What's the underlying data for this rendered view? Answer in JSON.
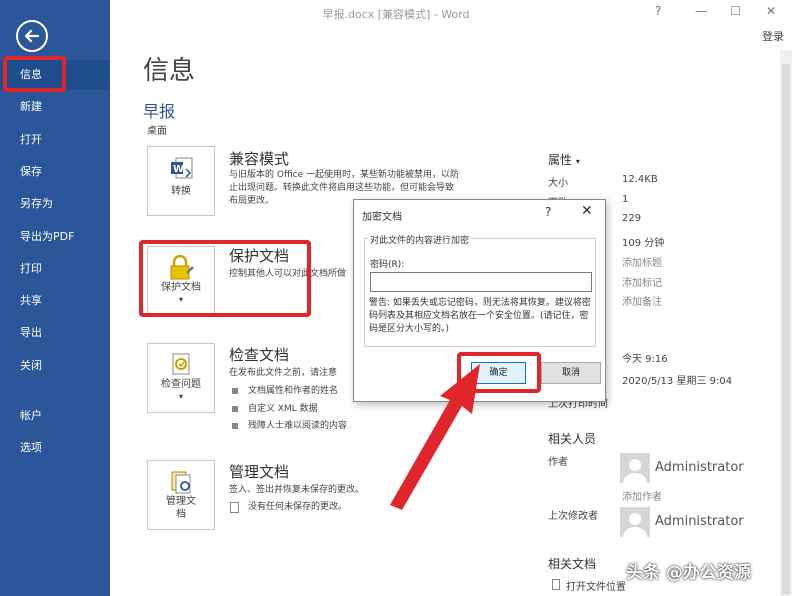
{
  "titlebar": {
    "title": "早报.docx [兼容模式] - Word",
    "help": "?",
    "minimize": "—",
    "restore": "☐",
    "close": "✕",
    "login": "登录"
  },
  "sidebar": {
    "items": [
      {
        "label": "信息"
      },
      {
        "label": "新建"
      },
      {
        "label": "打开"
      },
      {
        "label": "保存"
      },
      {
        "label": "另存为"
      },
      {
        "label": "导出为PDF"
      },
      {
        "label": "打印"
      },
      {
        "label": "共享"
      },
      {
        "label": "导出"
      },
      {
        "label": "关闭"
      },
      {
        "label": "帐户"
      },
      {
        "label": "选项"
      }
    ]
  },
  "main": {
    "page_title": "信息",
    "doc_name": "早报",
    "doc_location": "桌面",
    "sections": {
      "compat": {
        "tile_label": "转换",
        "title": "兼容模式",
        "desc": [
          "与旧版本的 Office 一起使用时，某些新功能被禁用，以防",
          "止出现问题。转换此文件将启用这些功能，但可能会导致",
          "布局更改。"
        ]
      },
      "protect": {
        "tile_label": "保护文档",
        "title": "保护文档",
        "desc": "控制其他人可以对此文档所做"
      },
      "inspect": {
        "tile_label": "检查问题",
        "title": "检查文档",
        "desc": "在发布此文件之前，请注意",
        "bullets": [
          "文档属性和作者的姓名",
          "自定义 XML 数据",
          "残障人士难以阅读的内容"
        ]
      },
      "manage": {
        "tile_label_1": "管理文",
        "tile_label_2": "档",
        "title": "管理文档",
        "desc": "签入、签出并恢复未保存的更改。",
        "note": "没有任何未保存的更改。"
      }
    }
  },
  "properties": {
    "header": "属性",
    "size_label": "大小",
    "size_value": "12.4KB",
    "pages_label": "页数",
    "pages_value": "1",
    "words_value": "229",
    "edit_time_value": "109 分钟",
    "add_title": "添加标题",
    "add_tag": "添加标记",
    "add_note": "添加备注",
    "modified_value": "今天 9:16",
    "created_value": "2020/5/13 星期三 9:04",
    "last_printed_label": "上次打印时间",
    "related_people_header": "相关人员",
    "author_label": "作者",
    "author_name": "Administrator",
    "add_author": "添加作者",
    "last_modified_by_label": "上次修改者",
    "last_modified_by_name": "Administrator",
    "related_docs_header": "相关文档",
    "open_location": "打开文件位置"
  },
  "dialog": {
    "title": "加密文档",
    "help": "?",
    "close": "✕",
    "group_title": "对此文件的内容进行加密",
    "password_label": "密码(R):",
    "password_value": "",
    "warning": "警告: 如果丢失或忘记密码，则无法将其恢复。建议将密码列表及其相应文档名放在一个安全位置。(请记住，密码是区分大小写的。)",
    "ok_label": "确定",
    "cancel_label": "取消"
  },
  "watermark": "头条 @办公资源",
  "colors": {
    "sidebar": "#2b579a",
    "accent_red": "#e0262a",
    "doc_name": "#2b579a"
  }
}
